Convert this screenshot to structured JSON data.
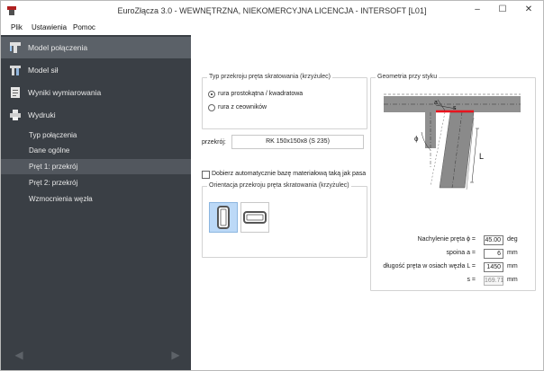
{
  "window": {
    "title": "EuroZłącza 3.0 - WEWNĘTRZNA, NIEKOMERCYJNA LICENCJA - INTERSOFT [L01]",
    "controls": {
      "minimize": "–",
      "maximize": "☐",
      "close": "✕"
    }
  },
  "menu": [
    "Plik",
    "Ustawienia",
    "Pomoc"
  ],
  "sidebar": {
    "main_items": [
      {
        "label": "Model połączenia",
        "icon": "connection-model-icon",
        "active": true
      },
      {
        "label": "Model sił",
        "icon": "forces-model-icon",
        "active": false
      },
      {
        "label": "Wyniki wymiarowania",
        "icon": "results-icon",
        "active": false
      },
      {
        "label": "Wydruki",
        "icon": "printer-icon",
        "active": false
      }
    ],
    "sub_items": [
      {
        "label": "Typ połączenia",
        "active": false
      },
      {
        "label": "Dane ogólne",
        "active": false
      },
      {
        "label": "Pręt 1: przekrój",
        "active": true
      },
      {
        "label": "Pręt 2: przekrój",
        "active": false
      },
      {
        "label": "Wzmocnienia węzła",
        "active": false
      }
    ],
    "nav": {
      "prev": "◀",
      "next": "▶"
    }
  },
  "section_type": {
    "title": "Typ przekroju pręta skratowania (krzyżulec)",
    "options": [
      {
        "label": "rura prostokątna / kwadratowa",
        "selected": true
      },
      {
        "label": "rura z ceowników",
        "selected": false
      }
    ]
  },
  "section": {
    "label": "przekrój:",
    "value": "RK 150x150x8 (S 235)"
  },
  "auto_match": {
    "label": "Dobierz automatycznie bazę materiałową taką jak pasa",
    "checked": false
  },
  "orientation": {
    "title": "Orientacja przekroju pręta skratowania (krzyżulec)",
    "options": [
      {
        "name": "vertical",
        "selected": true
      },
      {
        "name": "horizontal",
        "selected": false
      }
    ]
  },
  "geometry": {
    "title": "Geometria przy styku",
    "drawing_labels": {
      "a": "a",
      "s": "s",
      "phi": "ϕ",
      "L": "L"
    },
    "params": [
      {
        "label": "Nachylenie pręta ϕ =",
        "value": "45.00",
        "unit": "deg",
        "readonly": false
      },
      {
        "label": "spoina a =",
        "value": "6",
        "unit": "mm",
        "readonly": false
      },
      {
        "label": "długość pręta w osiach węzła L =",
        "value": "1450",
        "unit": "mm",
        "readonly": false
      },
      {
        "label": "s =",
        "value": "169.71",
        "unit": "mm",
        "readonly": true
      }
    ]
  },
  "colors": {
    "sidebar_bg": "#3a3f45",
    "sidebar_active": "#5b6168",
    "weld_red": "#e8141e",
    "selected_option": "#bcd9f7"
  }
}
